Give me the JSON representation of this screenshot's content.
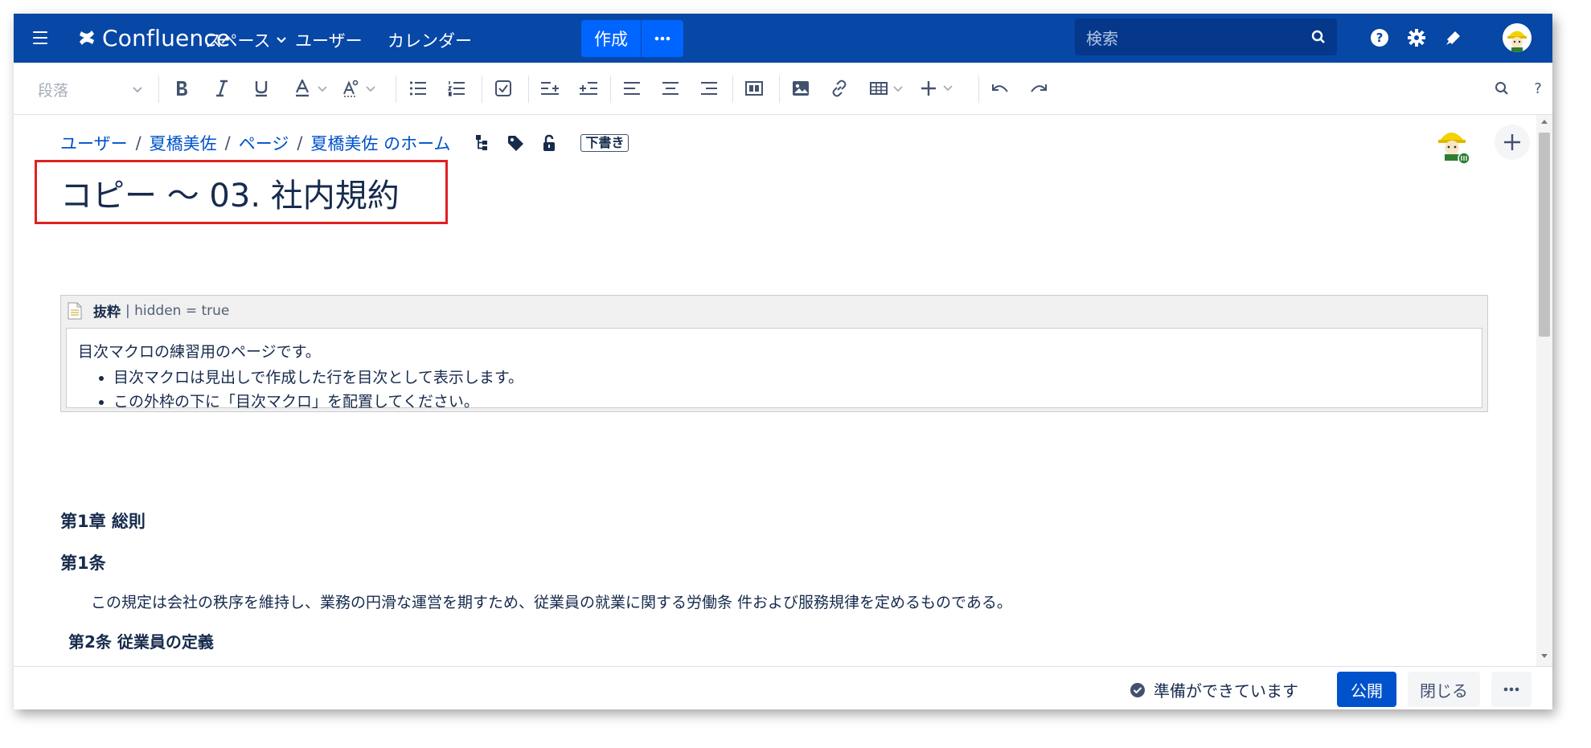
{
  "nav": {
    "logo": "Confluence",
    "items": [
      "スペース",
      "ユーザー",
      "カレンダー"
    ],
    "create": "作成",
    "search_placeholder": "検索"
  },
  "toolbar": {
    "paragraph_style": "段落"
  },
  "breadcrumb": [
    "ユーザー",
    "夏橋美佐",
    "ページ",
    "夏橋美佐 のホーム"
  ],
  "draft_badge": "下書き",
  "page": {
    "title": "コピー ～ 03. 社内規約"
  },
  "excerpt": {
    "macro_name": "抜粋",
    "params": "| hidden = true",
    "lead": "目次マクロの練習用のページです。",
    "bullets": [
      "目次マクロは見出しで作成した行を目次として表示します。",
      "この外枠の下に「目次マクロ」を配置してください。"
    ]
  },
  "body": {
    "chapter": "第1章 総則",
    "article1_heading": "第1条",
    "article1_text": "この規定は会社の秩序を維持し、業務の円滑な運営を期すため、従業員の就業に関する労働条 件および服務規律を定めるものである。",
    "article2_heading": "第2条 従業員の定義"
  },
  "footer": {
    "status": "準備ができています",
    "publish": "公開",
    "close": "閉じる"
  },
  "colors": {
    "nav_bg": "#0747a6",
    "create_bg": "#0065ff",
    "publish_bg": "#0052cc",
    "highlight_border": "#e02020"
  }
}
